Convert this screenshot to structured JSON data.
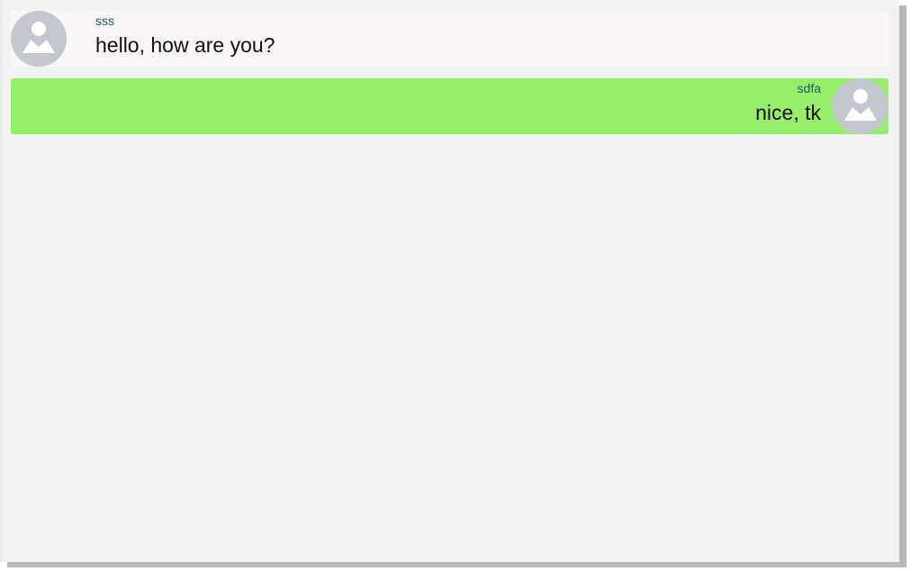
{
  "chat": {
    "messages": [
      {
        "direction": "received",
        "author": "sss",
        "text": "hello, how are you?",
        "avatar_icon": "user-icon"
      },
      {
        "direction": "sent",
        "author": "sdfa",
        "text": "nice, tk",
        "avatar_icon": "user-icon"
      }
    ]
  },
  "colors": {
    "panel_background": "#f2f2f2",
    "received_bubble": "#f9f6f5",
    "sent_bubble": "#96ee6c",
    "avatar_background": "#c3c7ce",
    "author_text": "#1f5e6e"
  }
}
